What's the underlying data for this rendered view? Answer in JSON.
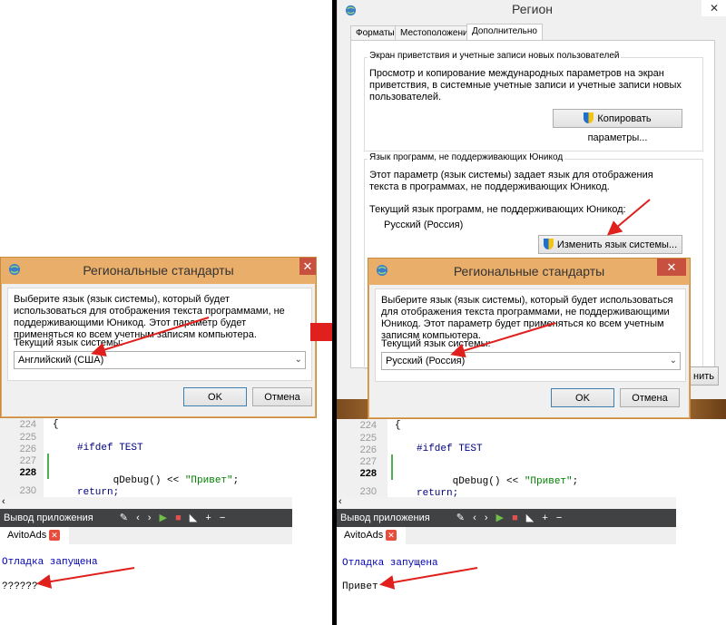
{
  "left": {
    "dialog": {
      "title": "Региональные стандарты",
      "close": "✕",
      "description": "Выберите язык (язык системы), который будет использоваться для отображения текста программами, не поддерживающими Юникод. Этот параметр будет применяться ко всем учетным записям компьютера.",
      "current_label": "Текущий язык системы:",
      "selected": "Английский (США)",
      "ok": "OK",
      "cancel": "Отмена"
    },
    "editor": {
      "lines": [
        "224",
        "225",
        "226",
        "227",
        "228",
        "230"
      ],
      "code": {
        "l224": "{",
        "l226": "#ifdef TEST",
        "l228_fn": "qDebug() << ",
        "l228_str": "\"Привет\"",
        "l228_end": ";",
        "l230": "return;"
      }
    },
    "output_pane": {
      "title": "Вывод приложения",
      "tab": "AvitoAds",
      "line1": "Отладка запущена",
      "line2": "??????"
    }
  },
  "right": {
    "region_window": {
      "title": "Регион",
      "tabs": [
        "Форматы",
        "Местоположение",
        "Дополнительно"
      ],
      "welcome_group": {
        "title": "Экран приветствия и учетные записи новых пользователей",
        "text": "Просмотр и копирование международных параметров на экран приветствия, в системные учетные записи и учетные записи новых пользователей.",
        "button": "Копировать параметры..."
      },
      "unicode_group": {
        "title": "Язык программ, не поддерживающих Юникод",
        "text": "Этот параметр (язык системы) задает язык для отображения текста в программах, не поддерживающих Юникод.",
        "current_label": "Текущий язык программ, не поддерживающих Юникод:",
        "current_value": "Русский (Россия)",
        "button": "Изменить язык системы..."
      },
      "partial_button": "нить"
    },
    "dialog": {
      "title": "Региональные стандарты",
      "close": "✕",
      "description": "Выберите язык (язык системы), который будет использоваться для отображения текста программами, не поддерживающими Юникод. Этот параметр будет применяться ко всем учетным записям компьютера.",
      "current_label": "Текущий язык системы:",
      "selected": "Русский (Россия)",
      "ok": "OK",
      "cancel": "Отмена"
    },
    "editor": {
      "lines": [
        "224",
        "225",
        "226",
        "227",
        "228",
        "230"
      ],
      "code": {
        "l224": "{",
        "l226": "#ifdef TEST",
        "l228_fn": "qDebug() << ",
        "l228_str": "\"Привет\"",
        "l228_end": ";",
        "l230": "return;"
      }
    },
    "output_pane": {
      "title": "Вывод приложения",
      "tab": "AvitoAds",
      "line1": "Отладка запущена",
      "line2": "Привет"
    }
  },
  "colors": {
    "caption": "#e8ae6a",
    "close": "#c7503f",
    "arrow": "#e0201c",
    "dark_toolbar": "#404244"
  }
}
